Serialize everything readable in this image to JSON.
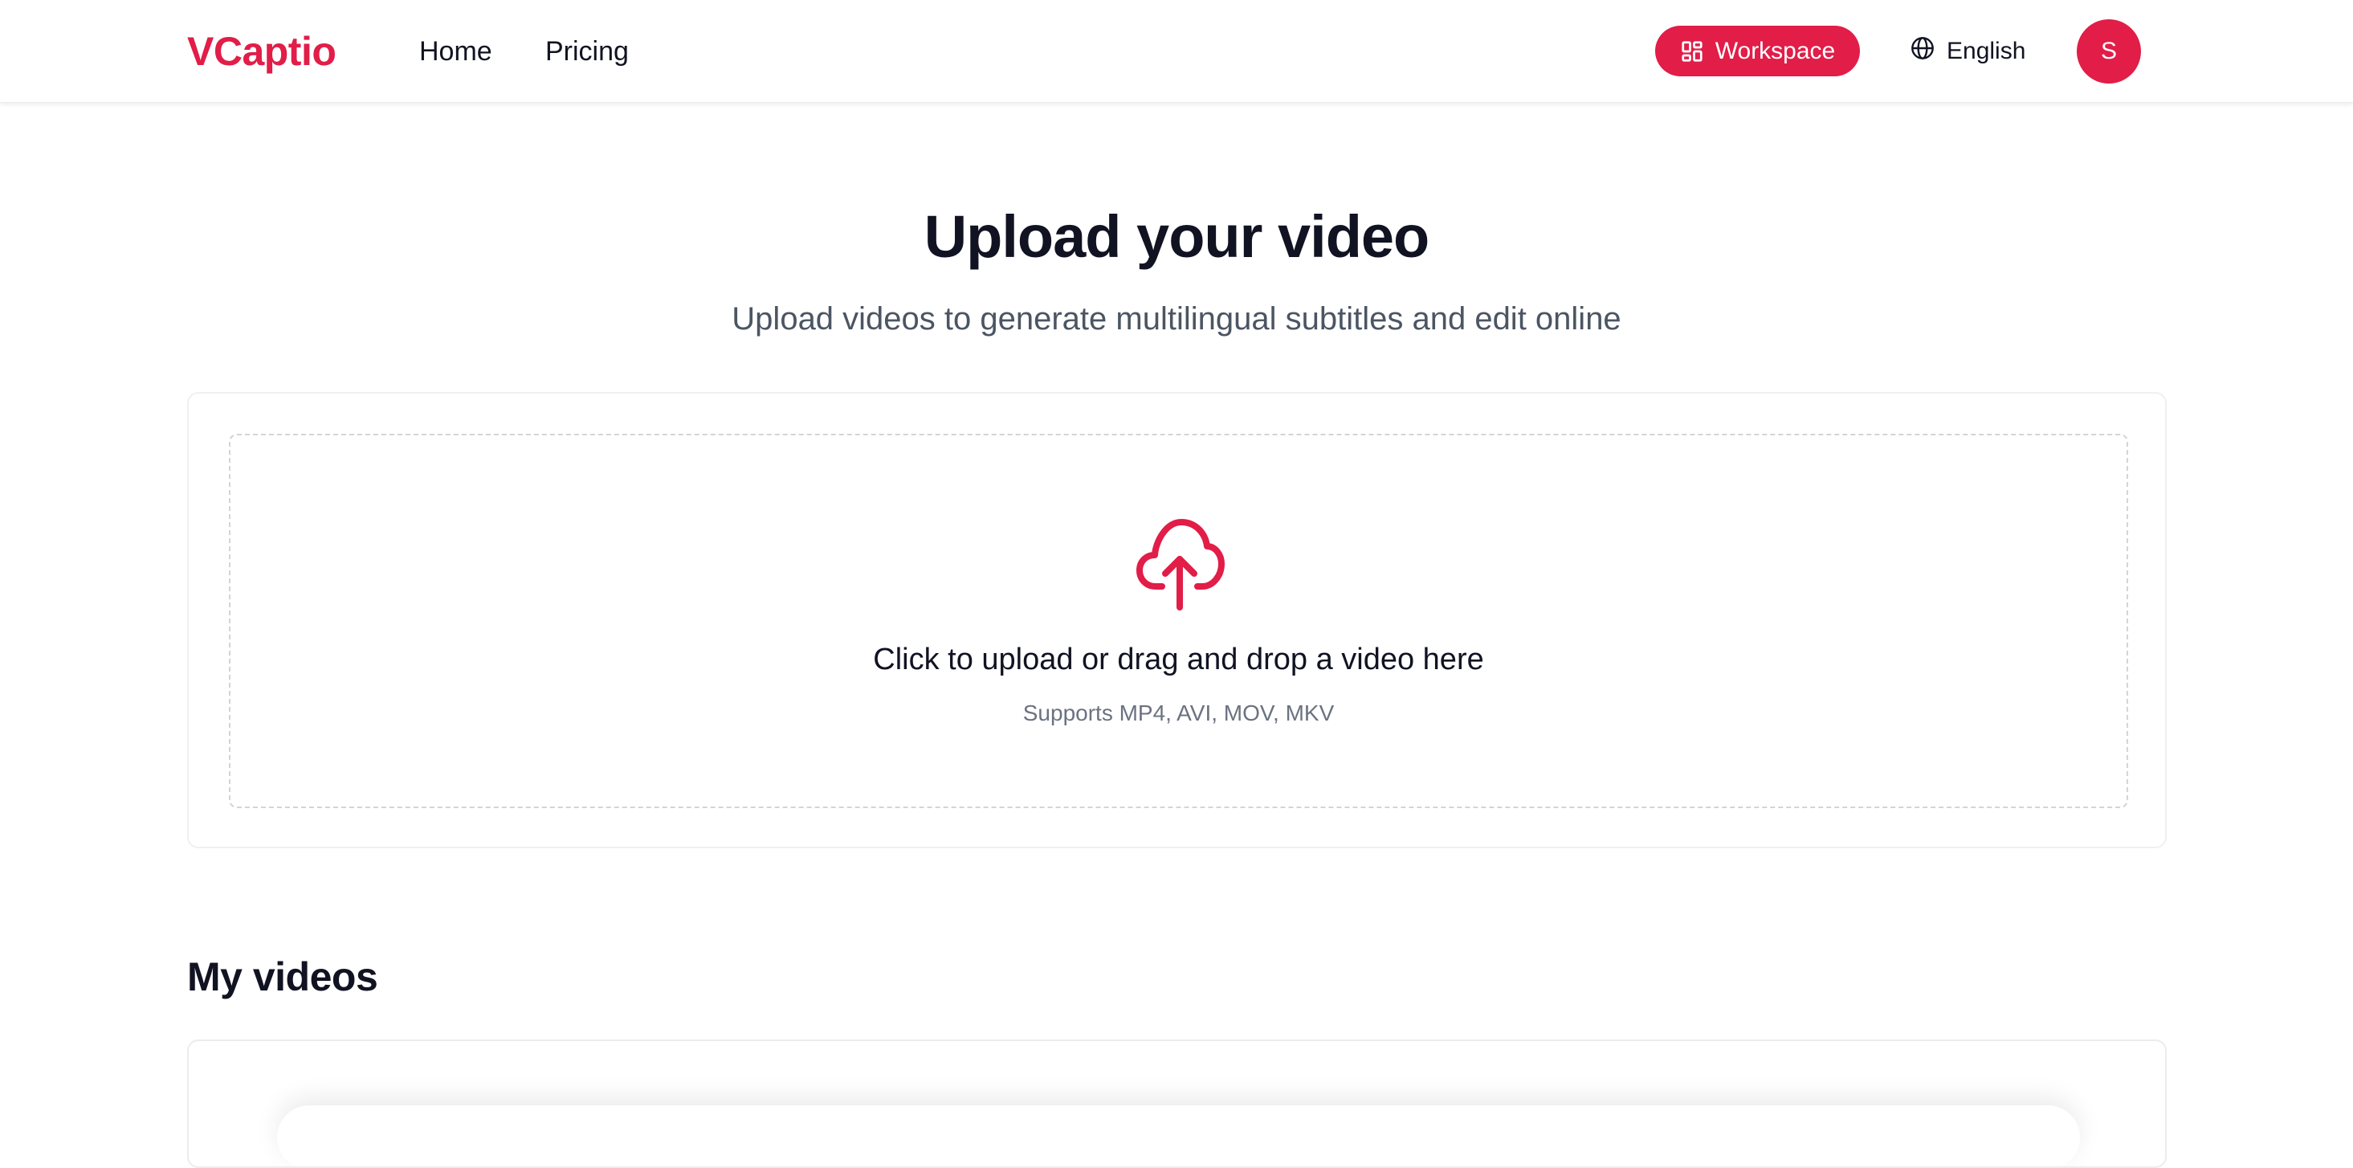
{
  "header": {
    "logo": "VCaptio",
    "nav": [
      {
        "label": "Home"
      },
      {
        "label": "Pricing"
      }
    ],
    "workspace_label": "Workspace",
    "language_label": "English",
    "avatar_initial": "S"
  },
  "main": {
    "title": "Upload your video",
    "subtitle": "Upload videos to generate multilingual subtitles and edit online",
    "dropzone": {
      "primary_text": "Click to upload or drag and drop a video here",
      "hint": "Supports MP4, AVI, MOV, MKV"
    },
    "my_videos_title": "My videos"
  },
  "colors": {
    "accent": "#e11d48",
    "text_primary": "#111322",
    "text_secondary": "#4b5563"
  },
  "icons": {
    "workspace": "grid-icon",
    "language": "globe-icon",
    "upload": "cloud-upload-icon"
  }
}
